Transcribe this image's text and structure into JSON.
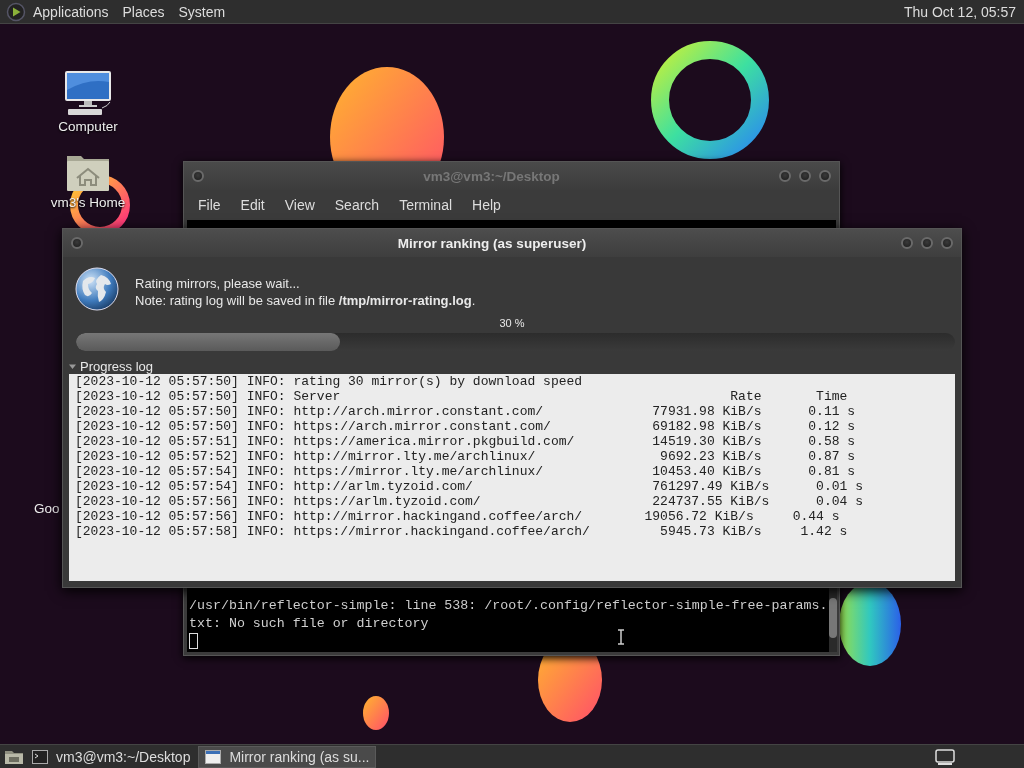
{
  "top_panel": {
    "menus": [
      "Applications",
      "Places",
      "System"
    ],
    "clock": "Thu Oct 12, 05:57"
  },
  "desktop_icons": [
    {
      "label": "Computer",
      "kind": "computer"
    },
    {
      "label": "vm3's Home",
      "kind": "home"
    },
    {
      "label": "Goo",
      "kind": "covered"
    }
  ],
  "terminal": {
    "title": "vm3@vm3:~/Desktop",
    "menus": [
      "File",
      "Edit",
      "View",
      "Search",
      "Terminal",
      "Help"
    ],
    "lines": [
      "/usr/bin/reflector-simple: line 538: /root/.config/reflector-simple-free-params.",
      "txt: No such file or directory"
    ]
  },
  "dialog": {
    "title": "Mirror ranking (as superuser)",
    "message": "Rating mirrors, please wait...",
    "note": "Note: rating log will be saved in file **/tmp/mirror-rating.log**.",
    "progress": {
      "label": "30 %",
      "level": 0.3
    },
    "log": {
      "label": "Progress log",
      "expanded": true,
      "lines": [
        "[2023-10-12 05:57:50] INFO: rating 30 mirror(s) by download speed",
        "[2023-10-12 05:57:50] INFO: Server                                                  Rate       Time",
        "[2023-10-12 05:57:50] INFO: http://arch.mirror.constant.com/              77931.98 KiB/s      0.11 s",
        "[2023-10-12 05:57:50] INFO: https://arch.mirror.constant.com/             69182.98 KiB/s      0.12 s",
        "[2023-10-12 05:57:51] INFO: https://america.mirror.pkgbuild.com/          14519.30 KiB/s      0.58 s",
        "[2023-10-12 05:57:52] INFO: http://mirror.lty.me/archlinux/                9692.23 KiB/s      0.87 s",
        "[2023-10-12 05:57:54] INFO: https://mirror.lty.me/archlinux/              10453.40 KiB/s      0.81 s",
        "[2023-10-12 05:57:54] INFO: http://arlm.tyzoid.com/                       761297.49 KiB/s      0.01 s",
        "[2023-10-12 05:57:56] INFO: https://arlm.tyzoid.com/                      224737.55 KiB/s      0.04 s",
        "[2023-10-12 05:57:56] INFO: http://mirror.hackingand.coffee/arch/        19056.72 KiB/s     0.44 s",
        "[2023-10-12 05:57:58] INFO: https://mirror.hackingand.coffee/arch/         5945.73 KiB/s     1.42 s"
      ]
    }
  },
  "taskbar": {
    "items": [
      {
        "label": "vm3@vm3:~/Desktop",
        "kind": "terminal",
        "selected": false
      },
      {
        "label": "Mirror ranking (as su...",
        "kind": "window",
        "selected": true
      }
    ]
  }
}
